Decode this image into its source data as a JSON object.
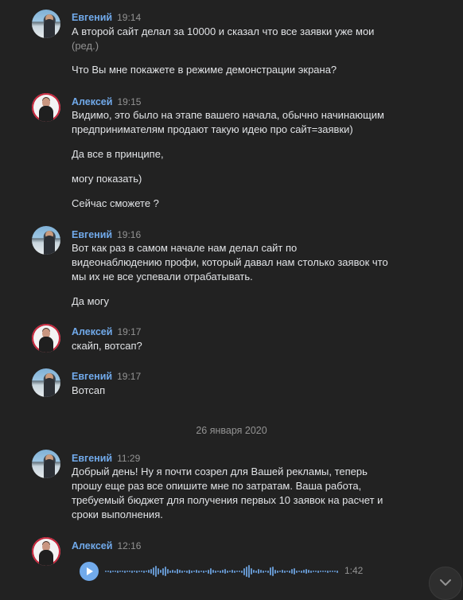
{
  "messages": [
    {
      "author": "Евгений",
      "time": "19:14",
      "avatar": "avatar-evgeniy",
      "lines": [
        "А второй сайт делал за 10000 и сказал что все заявки уже мои",
        "Что Вы мне покажете в режиме демонстрации экрана?"
      ],
      "edited": "(ред.)"
    },
    {
      "author": "Алексей",
      "time": "19:15",
      "avatar": "avatar-aleksey",
      "lines": [
        "Видимо, это было на этапе вашего начала, обычно начинающим",
        "предпринимателям продают такую идею про сайт=заявки)",
        "Да все в принципе,",
        "могу показать)",
        "Сейчас сможете ?"
      ]
    },
    {
      "author": "Евгений",
      "time": "19:16",
      "avatar": "avatar-evgeniy",
      "lines": [
        "Вот как раз в самом начале нам делал сайт по",
        "видеонаблюдению профи, который давал нам столько заявок что",
        "мы их не все успевали отрабатывать.",
        "Да могу"
      ]
    },
    {
      "author": "Алексей",
      "time": "19:17",
      "avatar": "avatar-aleksey",
      "lines": [
        "скайп, вотсап?"
      ]
    },
    {
      "author": "Евгений",
      "time": "19:17",
      "avatar": "avatar-evgeniy",
      "lines": [
        "Вотсап"
      ]
    },
    {
      "author": "Евгений",
      "time": "11:29",
      "avatar": "avatar-evgeniy",
      "lines": [
        "Добрый день! Ну я почти созрел для Вашей рекламы, теперь",
        "прошу еще раз все опишите мне по затратам. Ваша работа,",
        "требуемый бюджет для получения первых 10 заявок на расчет и",
        "сроки выполнения."
      ]
    },
    {
      "author": "Алексей",
      "time": "12:16",
      "avatar": "avatar-aleksey",
      "voice": {
        "duration": "1:42",
        "play_icon": "play-icon"
      }
    }
  ],
  "date_separator": "26 января 2020",
  "scroll_button_icon": "chevron-down-icon",
  "colors": {
    "background": "#222222",
    "author": "#71aaeb",
    "text": "#e1e3e6",
    "muted": "#939393",
    "accent": "#71aaeb"
  }
}
